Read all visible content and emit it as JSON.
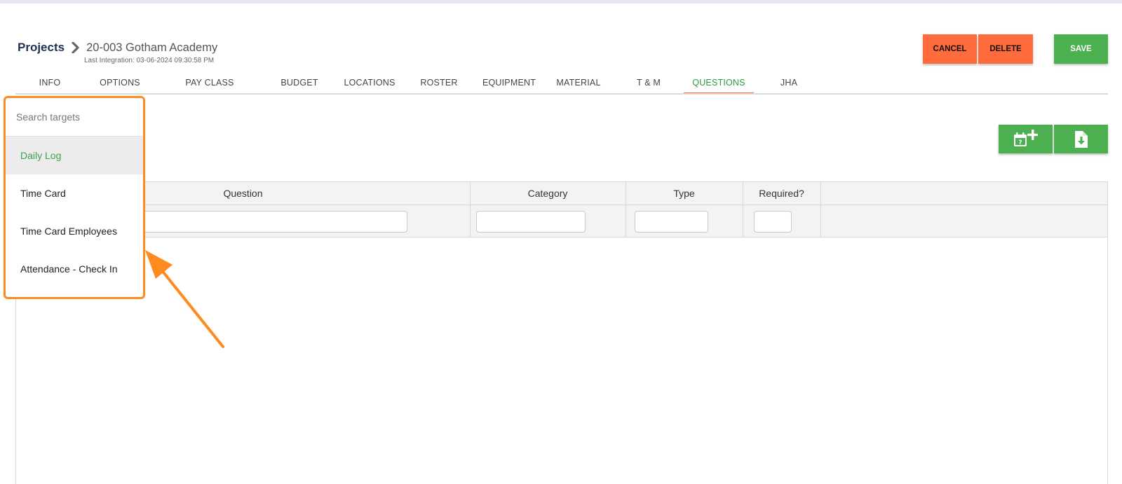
{
  "header": {
    "breadcrumb_root": "Projects",
    "project_name": "20-003 Gotham Academy",
    "last_integration": "Last Integration: 03-06-2024 09:30:58 PM"
  },
  "actions": {
    "cancel_label": "CANCEL",
    "delete_label": "DELETE",
    "save_label": "SAVE"
  },
  "tabs": [
    {
      "label": "INFO"
    },
    {
      "label": "OPTIONS"
    },
    {
      "label": "PAY CLASS"
    },
    {
      "label": "BUDGET"
    },
    {
      "label": "LOCATIONS"
    },
    {
      "label": "ROSTER"
    },
    {
      "label": "EQUIPMENT"
    },
    {
      "label": "MATERIAL"
    },
    {
      "label": "T & M"
    },
    {
      "label": "QUESTIONS"
    },
    {
      "label": "JHA"
    }
  ],
  "active_tab": "QUESTIONS",
  "toolbar": {
    "add_question_icon": "calendar-question-plus-icon",
    "download_icon": "file-download-icon"
  },
  "grid": {
    "columns": [
      "Question",
      "Category",
      "Type",
      "Required?"
    ]
  },
  "dropdown": {
    "search_placeholder": "Search targets",
    "items": [
      "Daily Log",
      "Time Card",
      "Time Card Employees",
      "Attendance - Check In"
    ],
    "selected": "Daily Log"
  },
  "colors": {
    "brand_green": "#4caf50",
    "danger_orange": "#ff6b3d",
    "highlight_orange": "#ff8a1f",
    "active_tab_green": "#2e9a3e",
    "breadcrumb_navy": "#1f3350"
  }
}
